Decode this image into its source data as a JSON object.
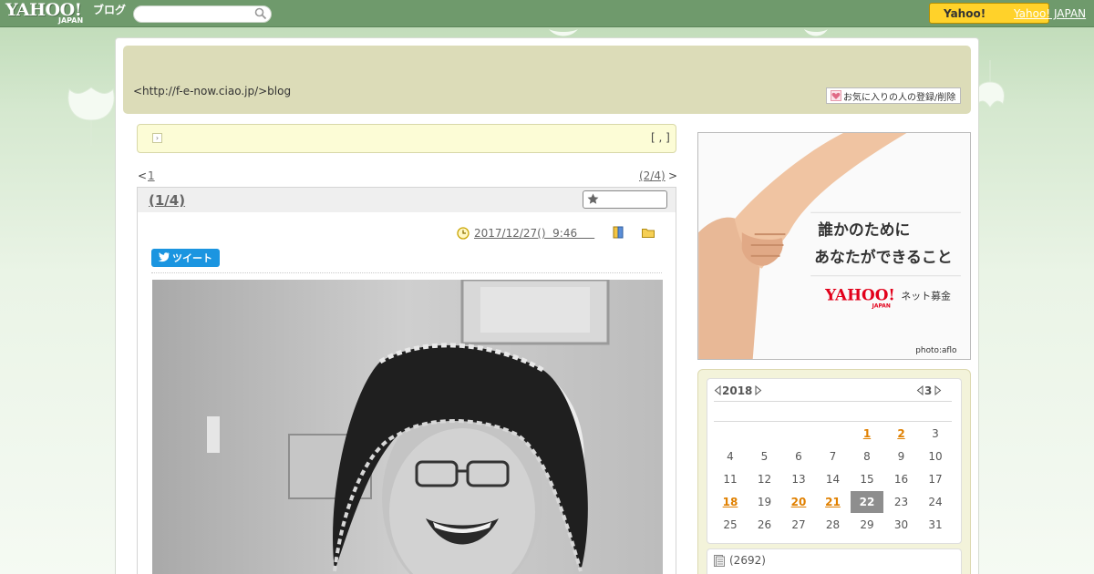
{
  "topbar": {
    "logo_text": "YAHOO!",
    "logo_sub": "JAPAN",
    "service_name": "ブログ",
    "search": {
      "value": "",
      "placeholder": ""
    },
    "yahoo_button_label": "Yahoo!",
    "yahoo_japan_link": "Yahoo! JAPAN"
  },
  "header": {
    "blog_url": "<http://f-e-now.ciao.jp/>blog",
    "favorite_button": "お気に入りの人の登録/削除"
  },
  "notice": {
    "arrow": "›",
    "brackets": "[ , ]"
  },
  "pagination": {
    "prev_symbol": "<",
    "prev_label": "1",
    "next_label": "(2/4)",
    "next_symbol": ">"
  },
  "article": {
    "title": "(1/4)",
    "date": "2017/12/27()  9:46     ",
    "tweet_label": "ツイート"
  },
  "banner": {
    "line1": "誰かのために",
    "line2": "あなたができること",
    "brand": "YAHOO!",
    "brand_sub": "JAPAN",
    "service": "ネット募金",
    "credit": "photo:aflo"
  },
  "calendar": {
    "year": "2018",
    "month": "3",
    "days": [
      [
        "",
        "",
        "",
        "",
        "1",
        "2",
        "3"
      ],
      [
        "4",
        "5",
        "6",
        "7",
        "8",
        "9",
        "10"
      ],
      [
        "11",
        "12",
        "13",
        "14",
        "15",
        "16",
        "17"
      ],
      [
        "18",
        "19",
        "20",
        "21",
        "22",
        "23",
        "24"
      ],
      [
        "25",
        "26",
        "27",
        "28",
        "29",
        "30",
        "31"
      ]
    ],
    "linked_days": [
      "1",
      "2",
      "18",
      "20",
      "21"
    ],
    "today": "22"
  },
  "sidebar": {
    "post_count": "(2692)"
  },
  "colors": {
    "topbar": "#6f9a6c",
    "header_box": "#dcdcb8",
    "calendar_link": "#e08000",
    "tweet": "#1b95e0",
    "yahoo_button": "#ffd22a"
  }
}
